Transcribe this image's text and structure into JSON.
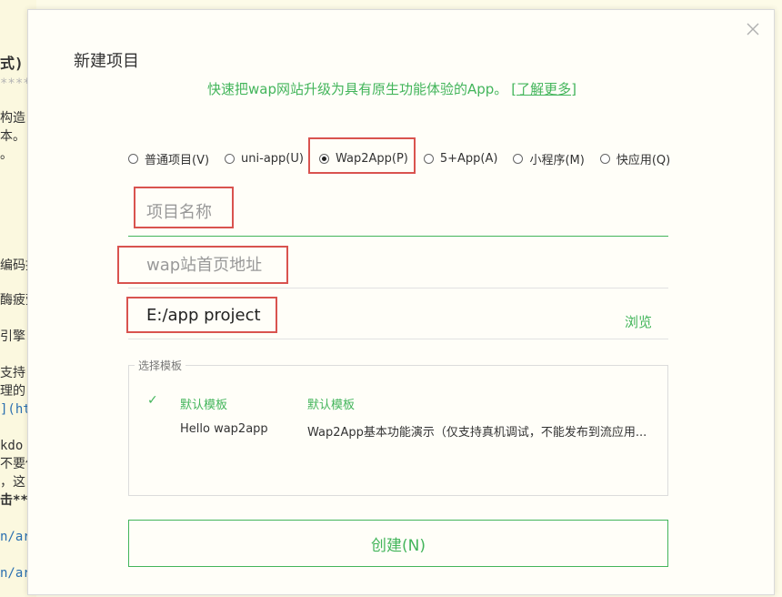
{
  "background_editor": {
    "lines": [
      "式)",
      "****",
      "构造",
      "本。",
      "。",
      "编码提",
      "酶疲劳",
      "引擎",
      "支持",
      "理的",
      "](ht",
      "kdo",
      "不要使",
      "，这",
      "击**",
      "n/ar",
      "n/ar"
    ]
  },
  "dialog": {
    "title": "新建项目",
    "subtitle": "快速把wap网站升级为具有原生功能体验的App。",
    "learn_more": "[了解更多]",
    "project_types": [
      {
        "label": "普通项目(V)",
        "selected": false
      },
      {
        "label": "uni-app(U)",
        "selected": false
      },
      {
        "label": "Wap2App(P)",
        "selected": true
      },
      {
        "label": "5+App(A)",
        "selected": false
      },
      {
        "label": "小程序(M)",
        "selected": false
      },
      {
        "label": "快应用(Q)",
        "selected": false
      }
    ],
    "project_name": {
      "value": "",
      "placeholder": "项目名称"
    },
    "wap_url": {
      "value": "",
      "placeholder": "wap站首页地址"
    },
    "location": {
      "value": "E:/app project",
      "placeholder": ""
    },
    "browse_label": "浏览",
    "template_section": {
      "legend": "选择模板",
      "templates": [
        {
          "name": "默认模板",
          "description": "默认模板",
          "selected": true
        },
        {
          "name": "Hello wap2app",
          "description": "Wap2App基本功能演示（仅支持真机调试，不能发布到流应用...",
          "selected": false
        }
      ]
    },
    "create_label": "创建(N)"
  },
  "colors": {
    "accent": "#43b55b",
    "highlight": "#d9534f"
  }
}
